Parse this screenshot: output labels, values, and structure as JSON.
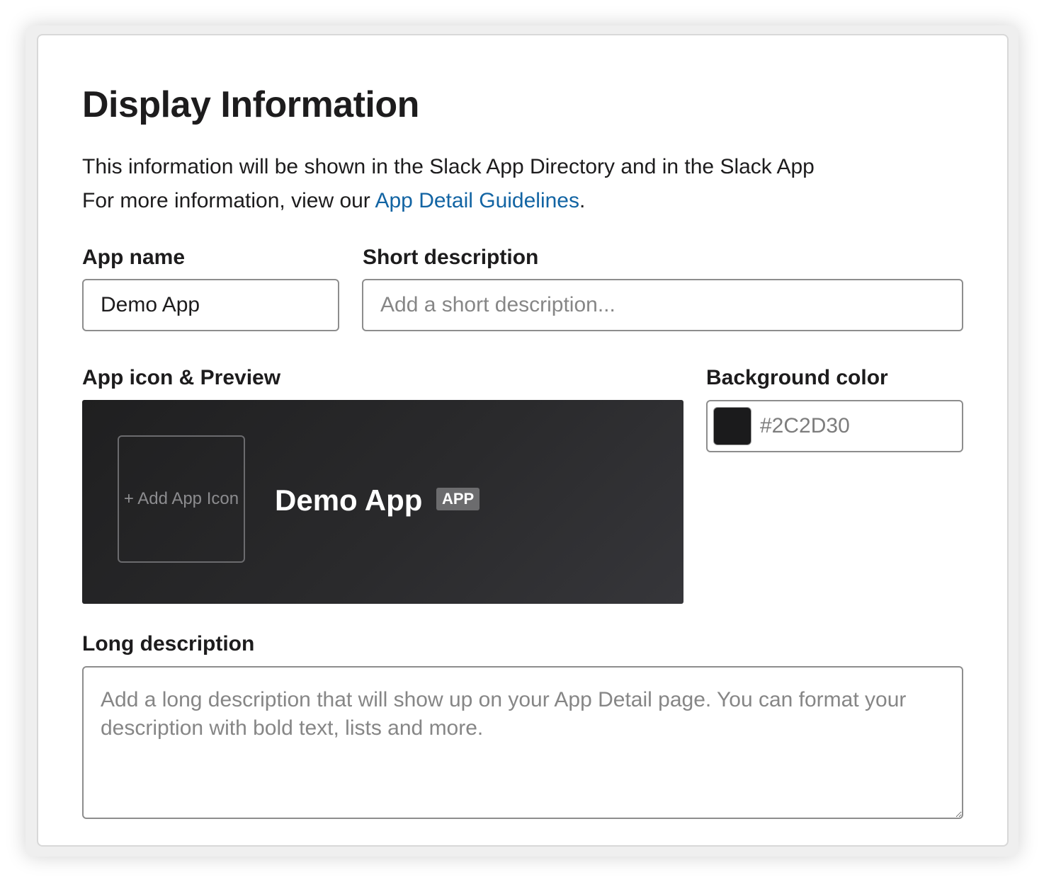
{
  "header": {
    "title": "Display Information",
    "intro_line1": "This information will be shown in the Slack App Directory and in the Slack App",
    "intro_line2_prefix": "For more information, view our ",
    "intro_link": "App Detail Guidelines",
    "intro_line2_suffix": "."
  },
  "app_name": {
    "label": "App name",
    "value": "Demo App"
  },
  "short_description": {
    "label": "Short description",
    "placeholder": "Add a short description..."
  },
  "icon_preview": {
    "label": "App icon & Preview",
    "add_icon_text": "+ Add App Icon",
    "app_name": "Demo App",
    "badge": "APP"
  },
  "background_color": {
    "label": "Background color",
    "value": "#2C2D30",
    "swatch_color": "#1b1b1c"
  },
  "long_description": {
    "label": "Long description",
    "placeholder": "Add a long description that will show up on your App Detail page. You can format your description with bold text, lists and more."
  }
}
